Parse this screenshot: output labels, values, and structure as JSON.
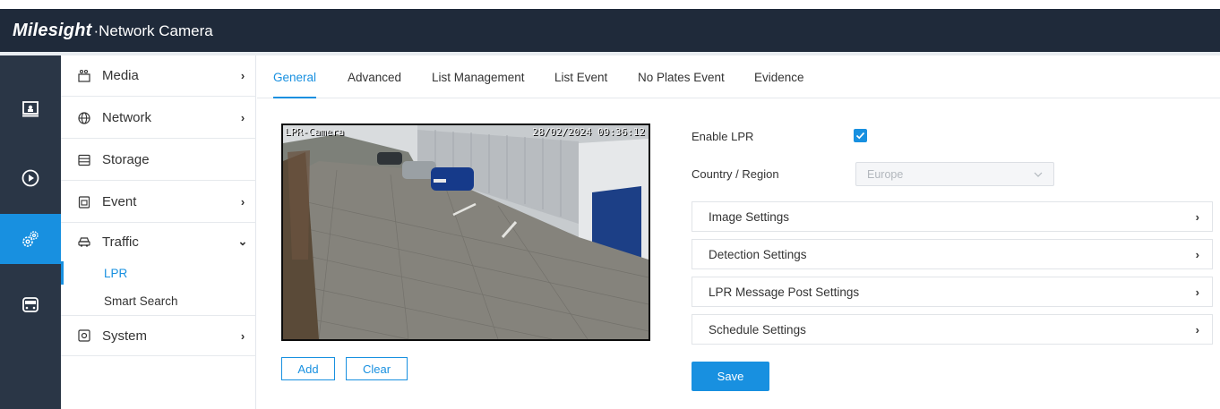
{
  "header": {
    "brand": "Milesight",
    "product": "·Network Camera"
  },
  "rail": {
    "items": [
      {
        "icon": "live-view-icon"
      },
      {
        "icon": "playback-icon"
      },
      {
        "icon": "settings-icon",
        "active": true
      },
      {
        "icon": "vehicle-icon"
      }
    ]
  },
  "sidebar": {
    "items": [
      {
        "label": "Media",
        "icon": "media-icon",
        "arrow": "›"
      },
      {
        "label": "Network",
        "icon": "globe-icon",
        "arrow": "›"
      },
      {
        "label": "Storage",
        "icon": "storage-icon"
      },
      {
        "label": "Event",
        "icon": "event-icon",
        "arrow": "›"
      },
      {
        "label": "Traffic",
        "icon": "car-icon",
        "arrow": "⌄"
      },
      {
        "label": "System",
        "icon": "system-icon",
        "arrow": "›"
      }
    ],
    "sub_items": [
      {
        "label": "LPR",
        "active": true
      },
      {
        "label": "Smart Search"
      }
    ]
  },
  "tabs": [
    {
      "label": "General",
      "active": true
    },
    {
      "label": "Advanced"
    },
    {
      "label": "List Management"
    },
    {
      "label": "List Event"
    },
    {
      "label": "No Plates Event"
    },
    {
      "label": "Evidence"
    }
  ],
  "preview": {
    "osd_name": "LPR-Camera",
    "osd_time": "28/02/2024 09:36:12"
  },
  "buttons": {
    "add": "Add",
    "clear": "Clear",
    "save": "Save"
  },
  "form": {
    "enable_lpr_label": "Enable LPR",
    "enable_lpr_checked": true,
    "country_label": "Country / Region",
    "country_value": "Europe"
  },
  "sections": [
    {
      "label": "Image Settings"
    },
    {
      "label": "Detection Settings"
    },
    {
      "label": "LPR Message Post Settings"
    },
    {
      "label": "Schedule Settings"
    }
  ],
  "colors": {
    "accent": "#1890e0",
    "header_bg": "#1f2a3a",
    "rail_bg": "#2a3646"
  }
}
